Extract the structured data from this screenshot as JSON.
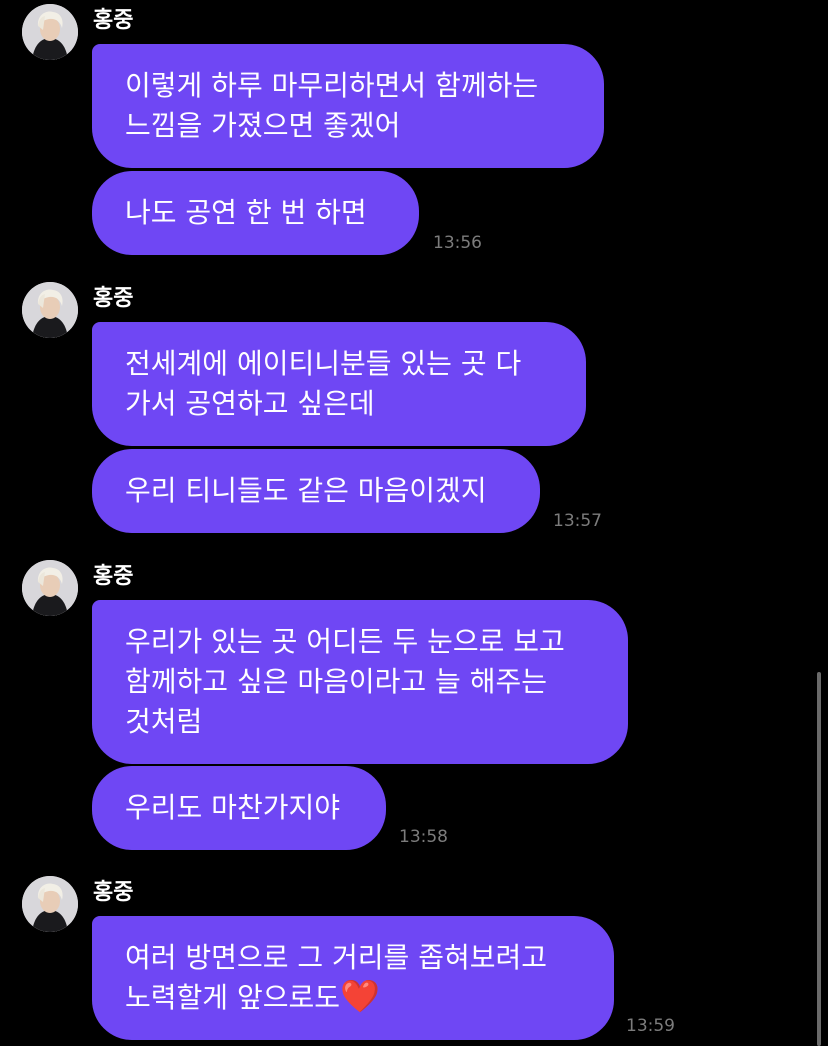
{
  "chat": {
    "groups": [
      {
        "sender": "홍중",
        "avatar_icon": "profile-avatar",
        "messages": [
          "이렇게 하루 마무리하면서 함께하는\n느낌을 가졌으면 좋겠어",
          "나도 공연 한 번 하면"
        ],
        "time": "13:56"
      },
      {
        "sender": "홍중",
        "avatar_icon": "profile-avatar",
        "messages": [
          "전세계에 에이티니분들 있는 곳 다\n가서 공연하고 싶은데",
          "우리 티니들도 같은 마음이겠지"
        ],
        "time": "13:57"
      },
      {
        "sender": "홍중",
        "avatar_icon": "profile-avatar",
        "messages": [
          "우리가 있는 곳 어디든 두 눈으로 보고\n함께하고 싶은 마음이라고 늘 해주는\n것처럼",
          "우리도 마찬가지야"
        ],
        "time": "13:58"
      },
      {
        "sender": "홍중",
        "avatar_icon": "profile-avatar",
        "messages": [
          "여러 방면으로 그 거리를 좁혀보려고\n노력할게 앞으로도"
        ],
        "emoji": "❤️",
        "time": "13:59"
      }
    ]
  },
  "colors": {
    "background": "#000000",
    "bubble": "#6f47f4",
    "text": "#ffffff",
    "timestamp": "#7c7c7c",
    "heart": "#e0262c"
  }
}
